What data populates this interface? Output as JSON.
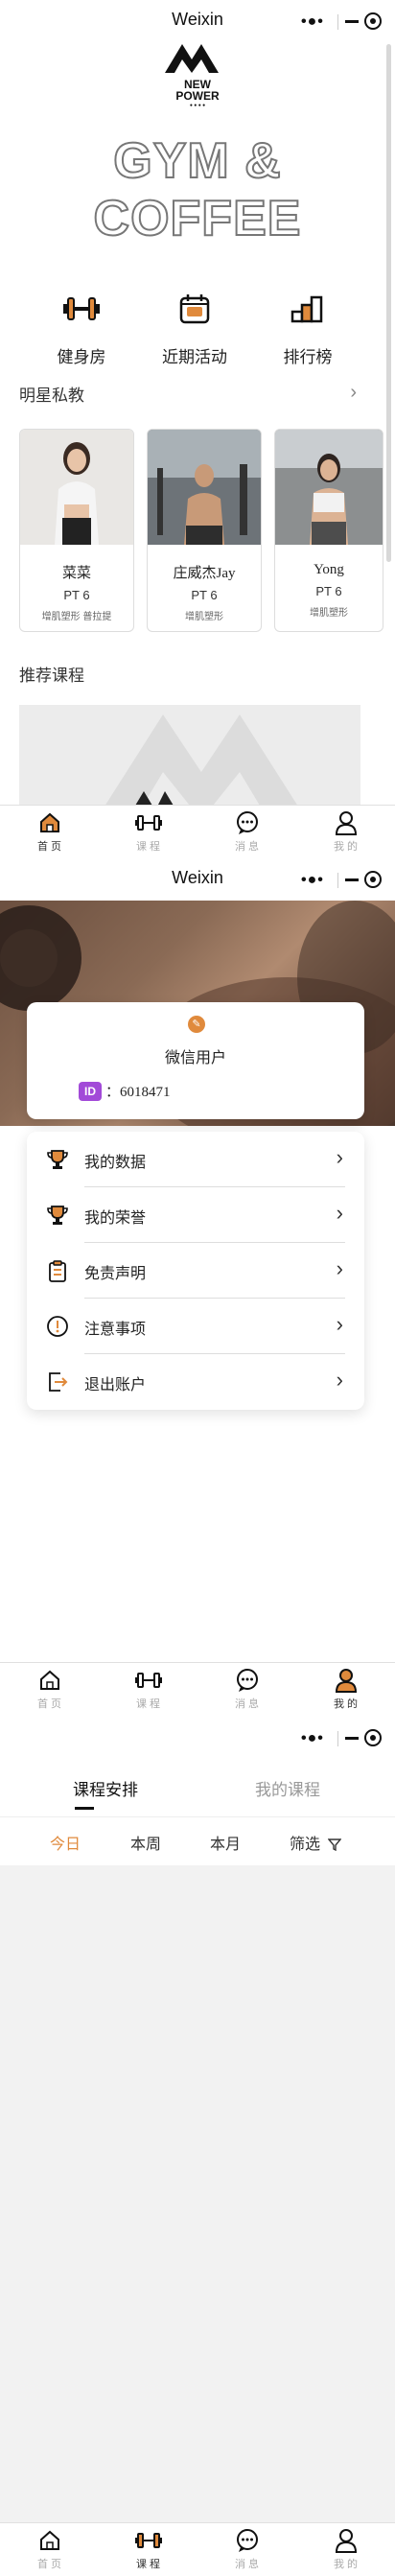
{
  "screen1": {
    "status_title": "Weixin",
    "hero_text": "GYM & COFFEE",
    "features": [
      {
        "label": "健身房",
        "icon": "dumbbell-icon"
      },
      {
        "label": "近期活动",
        "icon": "calendar-icon"
      },
      {
        "label": "排行榜",
        "icon": "ranking-icon"
      }
    ],
    "coaches_title": "明星私教",
    "coaches": [
      {
        "name": "菜菜",
        "level": "PT 6",
        "tags": "增肌塑形 普拉提"
      },
      {
        "name": "庄威杰Jay",
        "level": "PT 6",
        "tags": "增肌塑形"
      },
      {
        "name": "Yong",
        "level": "PT 6",
        "tags": "增肌塑形"
      }
    ],
    "courses_title": "推荐课程"
  },
  "tabbar": [
    {
      "label": "首 页",
      "icon": "home-icon"
    },
    {
      "label": "课 程",
      "icon": "dumbbell-icon"
    },
    {
      "label": "消 息",
      "icon": "message-icon"
    },
    {
      "label": "我 的",
      "icon": "user-icon"
    }
  ],
  "screen2": {
    "status_title": "Weixin",
    "user_name": "微信用户",
    "user_id_label": "ID",
    "user_id": "：6018471",
    "menu": [
      {
        "label": "我的数据",
        "icon": "trophy-icon"
      },
      {
        "label": "我的荣誉",
        "icon": "trophy-icon"
      },
      {
        "label": "免责声明",
        "icon": "clipboard-icon"
      },
      {
        "label": "注意事项",
        "icon": "warning-icon"
      },
      {
        "label": "退出账户",
        "icon": "logout-icon"
      }
    ]
  },
  "screen3": {
    "tabs": [
      "课程安排",
      "我的课程"
    ],
    "filters": [
      "今日",
      "本周",
      "本月",
      "筛选"
    ]
  },
  "colors": {
    "accent": "#e08a3c",
    "text": "#222222",
    "muted": "#aaaaaa",
    "id_badge": "#a24ad8"
  }
}
